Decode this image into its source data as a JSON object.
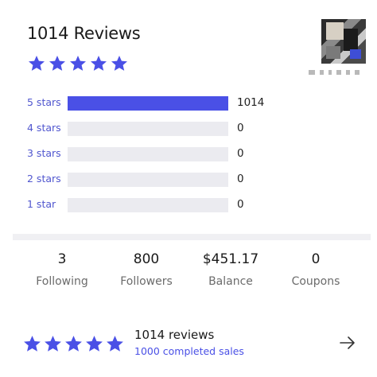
{
  "header": {
    "title": "1014 Reviews",
    "star_count": 5,
    "accent": "#4a50e6"
  },
  "profile": {
    "avatar_icon": "user-avatar-pixelated"
  },
  "breakdown": {
    "total": 1014,
    "rows": [
      {
        "label": "5 stars",
        "count": "1014",
        "fraction": 1.0
      },
      {
        "label": "4 stars",
        "count": "0",
        "fraction": 0
      },
      {
        "label": "3 stars",
        "count": "0",
        "fraction": 0
      },
      {
        "label": "2 stars",
        "count": "0",
        "fraction": 0
      },
      {
        "label": "1 star",
        "count": "0",
        "fraction": 0
      }
    ]
  },
  "stats": [
    {
      "value": "3",
      "label": "Following"
    },
    {
      "value": "800",
      "label": "Followers"
    },
    {
      "value": "$451.17",
      "label": "Balance"
    },
    {
      "value": "0",
      "label": "Coupons"
    }
  ],
  "summary": {
    "reviews": "1014 reviews",
    "sales": "1000 completed sales",
    "arrow_icon": "arrow-right-icon"
  },
  "colors": {
    "star": "#4a50e6",
    "bar_fill": "#4a50e6",
    "bar_track": "#ebebf0",
    "label": "#5056cf"
  }
}
